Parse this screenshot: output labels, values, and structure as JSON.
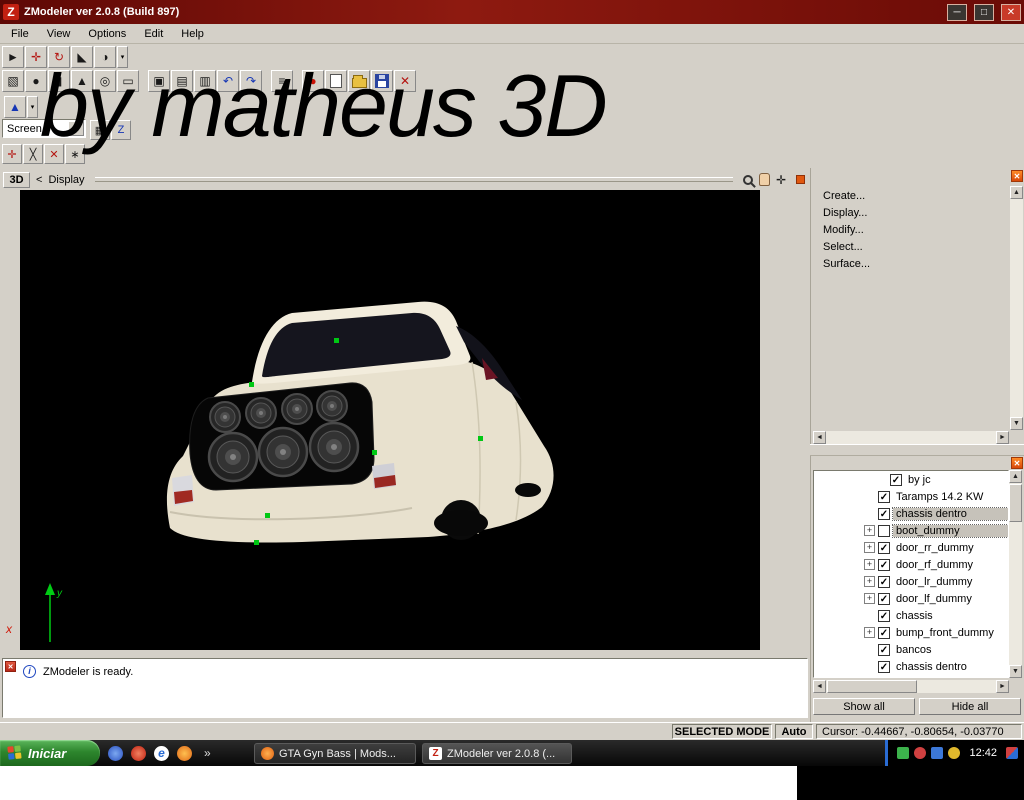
{
  "window": {
    "title": "ZModeler ver 2.0.8 (Build 897)",
    "watermark": "by matheus 3D",
    "logo_glyph": "Z",
    "minimize_glyph": "─",
    "maximize_glyph": "□",
    "close_glyph": "✕"
  },
  "menu": {
    "items": [
      "File",
      "View",
      "Options",
      "Edit",
      "Help"
    ]
  },
  "toolbars": {
    "row1": [
      {
        "name": "select-mode",
        "glyph": "►"
      },
      {
        "name": "move-tool",
        "glyph": "✛"
      },
      {
        "name": "rotate-tool",
        "glyph": "↻"
      },
      {
        "name": "scale-tool",
        "glyph": "◣"
      },
      {
        "name": "mirror-tool",
        "glyph": "◑"
      },
      {
        "name": "more-modes",
        "glyph": "▾"
      }
    ],
    "row2": [
      {
        "name": "create-box",
        "glyph": "▧"
      },
      {
        "name": "create-sphere",
        "glyph": "●"
      },
      {
        "name": "create-cylinder",
        "glyph": "▮"
      },
      {
        "name": "create-cone",
        "glyph": "▲"
      },
      {
        "name": "create-torus",
        "glyph": "◎"
      },
      {
        "name": "create-plane",
        "glyph": "▭"
      },
      {
        "name": "copy",
        "glyph": "▣"
      },
      {
        "name": "paste",
        "glyph": "▤"
      },
      {
        "name": "array",
        "glyph": "▥"
      },
      {
        "name": "undo",
        "glyph": "↶"
      },
      {
        "name": "redo",
        "glyph": "↷"
      },
      {
        "name": "layers",
        "glyph": "≡"
      },
      {
        "name": "render",
        "glyph": "●"
      }
    ],
    "delete_glyph": "✕",
    "screen_combo": "Screen",
    "combo_arrow": "▾",
    "pointer_glyph": "▲",
    "pointer_caret": "▾",
    "side_icons": [
      {
        "name": "grid-snap",
        "glyph": "▦"
      },
      {
        "name": "z-axis",
        "glyph": "Z"
      }
    ],
    "row3": [
      {
        "name": "vertex-tool",
        "glyph": "✛"
      },
      {
        "name": "edge-tool",
        "glyph": "╳"
      },
      {
        "name": "face-tool",
        "glyph": "✕"
      },
      {
        "name": "weld-tool",
        "glyph": "∗"
      }
    ]
  },
  "viewport": {
    "tab": "3D",
    "collapse": "<",
    "label": "Display",
    "pan_glyph": "✛",
    "axis_x": "x",
    "axis_y": "y"
  },
  "commands": [
    "Create...",
    "Display...",
    "Modify...",
    "Select...",
    "Surface..."
  ],
  "scroll": {
    "up": "▲",
    "down": "▼",
    "left": "◄",
    "right": "►"
  },
  "tree": {
    "items": [
      {
        "label": "by jc",
        "check": "✓",
        "plus": "",
        "selected": false
      },
      {
        "label": "Taramps 14.2 KW",
        "check": "✓",
        "plus": "",
        "selected": false
      },
      {
        "label": "chassis dentro",
        "check": "✓",
        "plus": "",
        "selected": true
      },
      {
        "label": "boot_dummy",
        "check": "",
        "plus": "+",
        "selected": true
      },
      {
        "label": "door_rr_dummy",
        "check": "✓",
        "plus": "+",
        "selected": false
      },
      {
        "label": "door_rf_dummy",
        "check": "✓",
        "plus": "+",
        "selected": false
      },
      {
        "label": "door_lr_dummy",
        "check": "✓",
        "plus": "+",
        "selected": false
      },
      {
        "label": "door_lf_dummy",
        "check": "✓",
        "plus": "+",
        "selected": false
      },
      {
        "label": "chassis",
        "check": "✓",
        "plus": "",
        "selected": false
      },
      {
        "label": "bump_front_dummy",
        "check": "✓",
        "plus": "+",
        "selected": false
      },
      {
        "label": "bancos",
        "check": "✓",
        "plus": "",
        "selected": false
      },
      {
        "label": "chassis dentro",
        "check": "✓",
        "plus": "",
        "selected": false
      }
    ]
  },
  "panel": {
    "show_all": "Show all",
    "hide_all": "Hide all",
    "close": "✕"
  },
  "message": {
    "close": "✕",
    "info": "i",
    "text": "ZModeler is ready."
  },
  "statusbar": {
    "mode": "SELECTED MODE",
    "auto": "Auto",
    "cursor": "Cursor: -0.44667, -0.80654, -0.03770"
  },
  "taskbar": {
    "start": "Iniciar",
    "ie_glyph": "e",
    "overflow": "»",
    "tasks": [
      {
        "label": "GTA Gyn Bass | Mods..."
      },
      {
        "label": "ZModeler ver 2.0.8 (..."
      }
    ],
    "z_glyph": "Z",
    "clock": "12:42"
  },
  "colors": {
    "titlebar": "#7a0c06",
    "selection": "#c6c2ba",
    "panel_close_orange": "#e05810",
    "start_green": "#2d862d"
  }
}
